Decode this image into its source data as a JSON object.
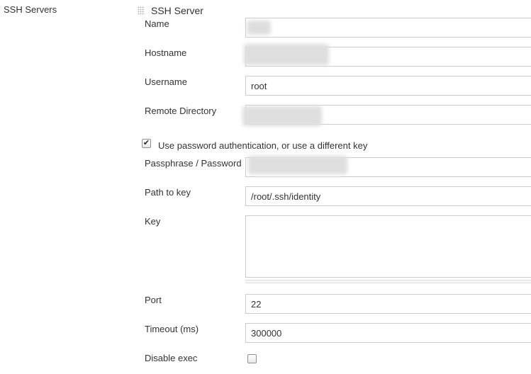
{
  "section": {
    "label": "SSH Servers",
    "title": "SSH Server"
  },
  "fields": {
    "name_label": "Name",
    "hostname_label": "Hostname",
    "username_label": "Username",
    "username_value": "root",
    "remote_dir_label": "Remote Directory",
    "use_password_label": "Use password authentication, or use a different key",
    "use_password_checked": true,
    "passphrase_label": "Passphrase / Password",
    "path_to_key_label": "Path to key",
    "path_to_key_value": "/root/.ssh/identity",
    "key_label": "Key",
    "key_value": "",
    "port_label": "Port",
    "port_value": "22",
    "timeout_label": "Timeout (ms)",
    "timeout_value": "300000",
    "disable_exec_label": "Disable exec",
    "disable_exec_checked": false
  },
  "icons": {
    "drag_handle": "drag-handle-icon",
    "check": "checkmark-icon"
  }
}
